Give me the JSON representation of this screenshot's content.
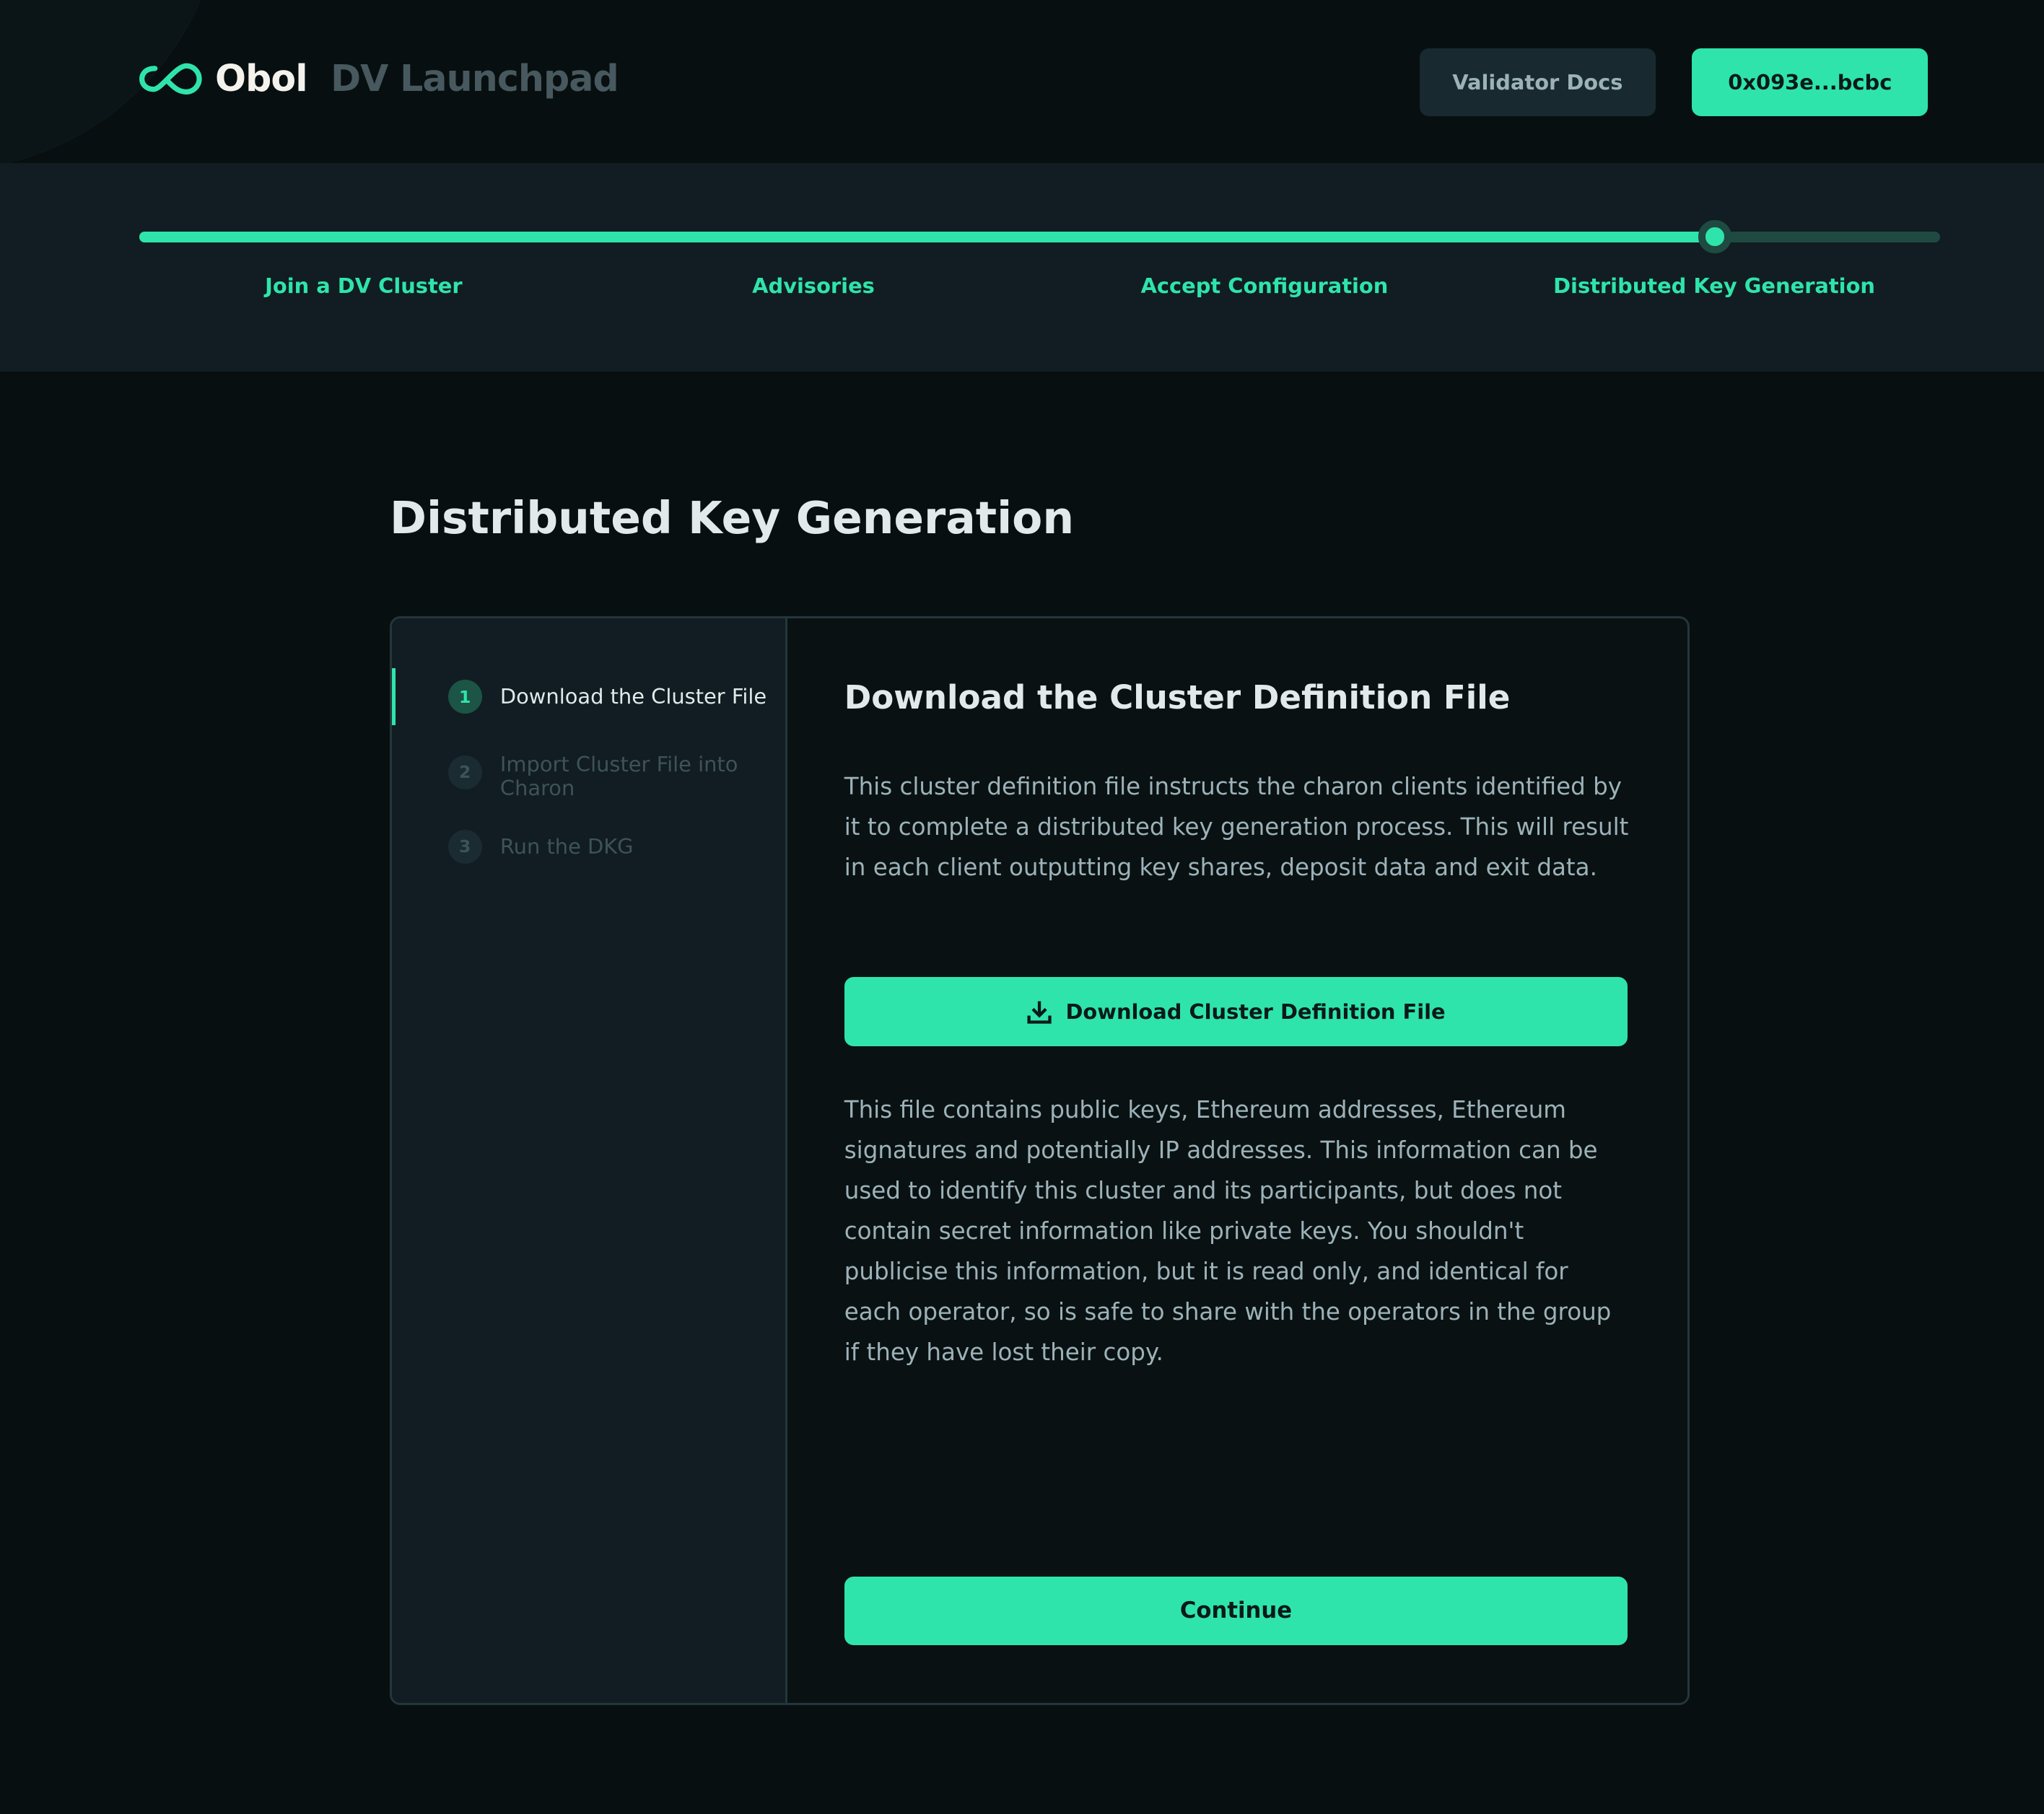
{
  "header": {
    "brand": "Obol",
    "product": "DV Launchpad",
    "docs_button": "Validator Docs",
    "wallet_button": "0x093e...bcbc"
  },
  "stepper": {
    "progress_percent": 87.5,
    "steps": [
      "Join a DV Cluster",
      "Advisories",
      "Accept Configuration",
      "Distributed Key Generation"
    ]
  },
  "page_title": "Distributed Key Generation",
  "substeps": [
    {
      "number": "1",
      "label": "Download the Cluster File",
      "active": true
    },
    {
      "number": "2",
      "label": "Import Cluster File into Charon",
      "active": false
    },
    {
      "number": "3",
      "label": "Run the DKG",
      "active": false
    }
  ],
  "content": {
    "heading": "Download the Cluster Definition File",
    "paragraph1": "This cluster definition file instructs the charon clients identified by it to complete a distributed key generation process. This will result in each client outputting key shares, deposit data and exit data.",
    "download_button": "Download Cluster Definition File",
    "paragraph2": "This file contains public keys, Ethereum addresses, Ethereum signatures and potentially IP addresses. This information can be used to identify this cluster and its participants, but does not contain secret information like private keys. You shouldn't publicise this information, but it is read only, and identical for each operator, so is safe to share with the operators in the group if they have lost their copy.",
    "continue_button": "Continue"
  },
  "colors": {
    "accent": "#2fe4ab",
    "background": "#080f11",
    "panel": "#111d22"
  }
}
